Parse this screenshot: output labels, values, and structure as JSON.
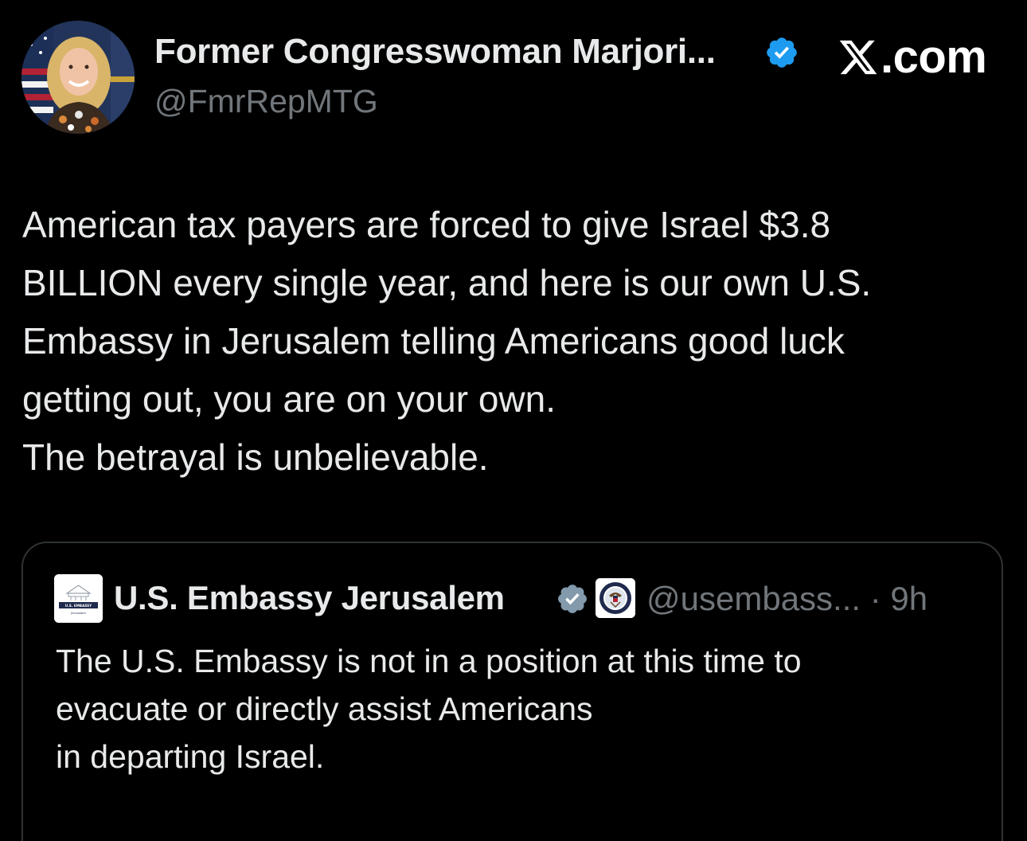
{
  "author": {
    "display_name": "Former Congresswoman Marjori...",
    "handle": "@FmrRepMTG"
  },
  "brand": {
    "label": ".com"
  },
  "tweet": {
    "lines": [
      "American tax payers are forced to give Israel $3.8",
      "BILLION every single year, and here is our own U.S.",
      "Embassy in Jerusalem telling Americans good luck",
      "getting out, you are on your own.",
      "The betrayal is unbelievable."
    ]
  },
  "quoted": {
    "display_name": "U.S. Embassy Jerusalem",
    "handle_time": "@usembass... · 9h",
    "logo_text": {
      "top": "U.S. EMBASSY",
      "bottom": "Jerusalem"
    },
    "lines": [
      "The U.S. Embassy is not in a position at this time to",
      "evacuate or directly assist Americans",
      "in departing Israel."
    ]
  },
  "colors": {
    "background": "#000000",
    "text_primary": "#e7e9ea",
    "text_secondary": "#71767b",
    "verified_blue": "#1d9bf0",
    "verified_gray": "#829aab",
    "border": "#2f3336"
  },
  "icons": {
    "verified": "verified-badge-icon",
    "government": "government-badge-icon",
    "x_logo": "x-logo-icon"
  }
}
